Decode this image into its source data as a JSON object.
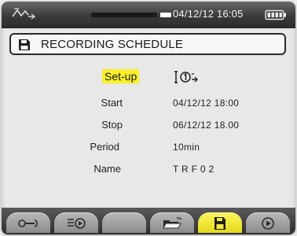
{
  "status_bar": {
    "datetime": "04/12/12  16:05",
    "icons": [
      "waveform-icon",
      "battery-icon"
    ],
    "progress_level": 0.9
  },
  "title_bar": {
    "icon": "floppy-disk-icon",
    "title": "RECORDING SCHEDULE"
  },
  "form": {
    "setup_label": "Set-up",
    "setup_value_icon": "recording-config-icon",
    "start_label": "Start",
    "start_value": "04/12/12 18:00",
    "stop_label": "Stop",
    "stop_value": "06/12/12 18.00",
    "period_label": "Period",
    "period_value": "10min",
    "name_label": "Name",
    "name_value": "T R F 0 2"
  },
  "function_keys": [
    {
      "icon": "wrench-icon",
      "active": false
    },
    {
      "icon": "list-play-icon",
      "active": false
    },
    {
      "icon": "blank-key",
      "active": false
    },
    {
      "icon": "open-folder-icon",
      "active": false
    },
    {
      "icon": "floppy-disk-icon",
      "active": true
    },
    {
      "icon": "play-circle-icon",
      "active": false
    }
  ],
  "colors": {
    "highlight": "#f7ef2a",
    "status_bar": "#3a3a3a",
    "screen_background": "#e8e8e6"
  }
}
